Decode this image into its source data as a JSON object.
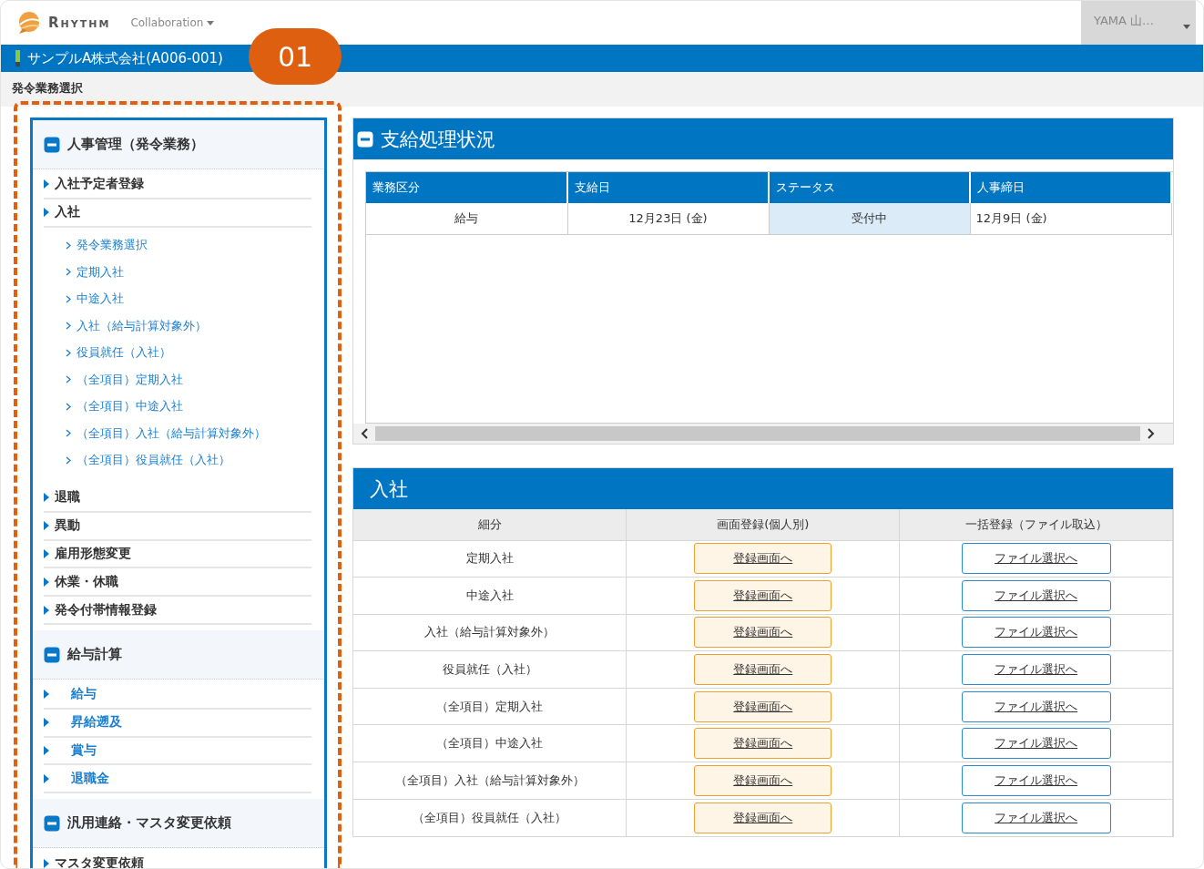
{
  "header": {
    "brand": "Rhythm",
    "app_menu": "Collaboration",
    "user": "YAMA 山…"
  },
  "company_bar": {
    "company": "サンプルA株式会社(A006-001)",
    "callout": "01"
  },
  "breadcrumb": "発令業務選択",
  "sidebar": {
    "sections": [
      {
        "title": "人事管理（発令業務）",
        "expanded": true,
        "items": [
          {
            "kind": "menu",
            "label": "入社予定者登録"
          },
          {
            "kind": "menu",
            "label": "入社",
            "children": [
              "発令業務選択",
              "定期入社",
              "中途入社",
              "入社（給与計算対象外）",
              "役員就任（入社）",
              "（全項目）定期入社",
              "（全項目）中途入社",
              "（全項目）入社（給与計算対象外）",
              "（全項目）役員就任（入社）"
            ]
          },
          {
            "kind": "menu",
            "label": "退職"
          },
          {
            "kind": "menu",
            "label": "異動"
          },
          {
            "kind": "menu",
            "label": "雇用形態変更"
          },
          {
            "kind": "menu",
            "label": "休業・休職"
          },
          {
            "kind": "menu",
            "label": "発令付帯情報登録"
          }
        ]
      },
      {
        "title": "給与計算",
        "expanded": true,
        "items": [
          {
            "kind": "link",
            "label": "給与"
          },
          {
            "kind": "link",
            "label": "昇給遡及"
          },
          {
            "kind": "link",
            "label": "賞与"
          },
          {
            "kind": "link",
            "label": "退職金"
          }
        ]
      },
      {
        "title": "汎用連絡・マスタ変更依頼",
        "expanded": true,
        "items": [
          {
            "kind": "menu",
            "label": "マスタ変更依頼"
          }
        ]
      }
    ]
  },
  "payment_panel": {
    "title": "支給処理状況",
    "expanded": true,
    "columns": [
      "業務区分",
      "支給日",
      "ステータス",
      "人事締日"
    ],
    "rows": [
      [
        {
          "text": "給与",
          "highlighted": false
        },
        {
          "text": "12月23日 (金)",
          "highlighted": false
        },
        {
          "text": "受付中",
          "highlighted": true
        },
        {
          "text": "12月9日 (金)",
          "highlighted": false
        }
      ]
    ]
  },
  "entry_panel": {
    "title": "入社",
    "columns": [
      "細分",
      "画面登録(個人別)",
      "一括登録（ファイル取込）"
    ],
    "rows": [
      {
        "name": "定期入社",
        "screen_button": "登録画面へ",
        "file_button": "ファイル選択へ"
      },
      {
        "name": "中途入社",
        "screen_button": "登録画面へ",
        "file_button": "ファイル選択へ"
      },
      {
        "name": "入社（給与計算対象外）",
        "screen_button": "登録画面へ",
        "file_button": "ファイル選択へ"
      },
      {
        "name": "役員就任（入社）",
        "screen_button": "登録画面へ",
        "file_button": "ファイル選択へ"
      },
      {
        "name": "（全項目）定期入社",
        "screen_button": "登録画面へ",
        "file_button": "ファイル選択へ"
      },
      {
        "name": "（全項目）中途入社",
        "screen_button": "登録画面へ",
        "file_button": "ファイル選択へ"
      },
      {
        "name": "（全項目）入社（給与計算対象外）",
        "screen_button": "登録画面へ",
        "file_button": "ファイル選択へ"
      },
      {
        "name": "（全項目）役員就任（入社）",
        "screen_button": "登録画面へ",
        "file_button": "ファイル選択へ"
      }
    ]
  }
}
